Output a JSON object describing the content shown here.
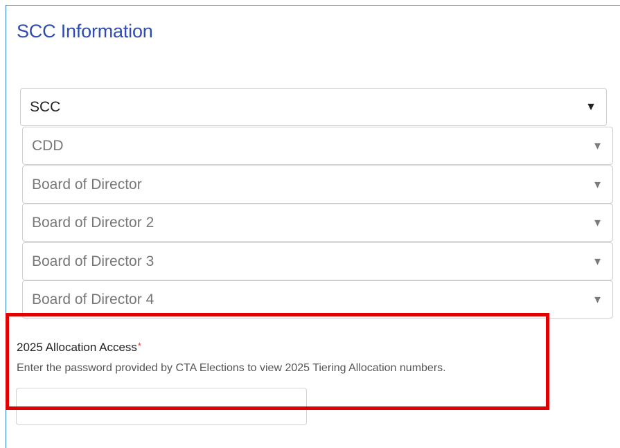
{
  "section": {
    "title": "SCC Information"
  },
  "selects": [
    {
      "value": "SCC",
      "arrow": "▼"
    },
    {
      "value": "CDD",
      "arrow": "▼"
    },
    {
      "value": "Board of Director",
      "arrow": "▼"
    },
    {
      "value": "Board of Director 2",
      "arrow": "▼"
    },
    {
      "value": "Board of Director 3",
      "arrow": "▼"
    },
    {
      "value": "Board of Director 4",
      "arrow": "▼"
    }
  ],
  "allocation": {
    "label": "2025 Allocation Access",
    "required_mark": "*",
    "helper": "Enter the password provided by CTA Elections to view 2025 Tiering Allocation numbers.",
    "value": ""
  },
  "colors": {
    "title": "#2f4db0",
    "highlight_box": "#e10000",
    "frame": "#2b78c6",
    "required": "#dd3333"
  }
}
